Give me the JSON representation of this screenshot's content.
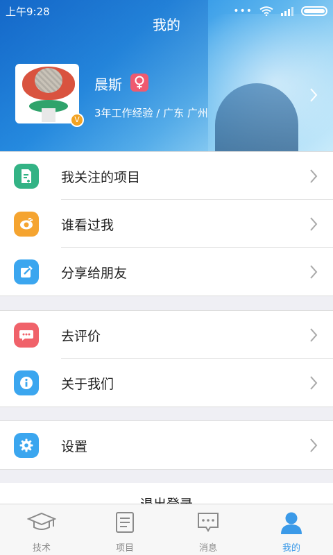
{
  "status_bar": {
    "time": "上午9:28",
    "dots": "•••"
  },
  "header": {
    "title": "我的",
    "user": {
      "name": "晨斯",
      "gender": "female",
      "vip_badge": "V",
      "meta": "3年工作经验 / 广东 广州"
    }
  },
  "menu_groups": [
    {
      "items": [
        {
          "label": "我关注的项目",
          "icon": "follow-project-icon",
          "color": "#33b385"
        },
        {
          "label": "谁看过我",
          "icon": "eye-icon",
          "color": "#f5a430"
        },
        {
          "label": "分享给朋友",
          "icon": "share-icon",
          "color": "#3ba6ef"
        }
      ]
    },
    {
      "items": [
        {
          "label": "去评价",
          "icon": "comment-icon",
          "color": "#f0626a"
        },
        {
          "label": "关于我们",
          "icon": "info-icon",
          "color": "#3ba6ef"
        }
      ]
    },
    {
      "items": [
        {
          "label": "设置",
          "icon": "gear-icon",
          "color": "#3ba6ef"
        }
      ]
    }
  ],
  "logout_label": "退出登录",
  "tabs": [
    {
      "label": "技术",
      "icon": "graduation-cap-icon",
      "active": false
    },
    {
      "label": "项目",
      "icon": "document-list-icon",
      "active": false
    },
    {
      "label": "消息",
      "icon": "message-icon",
      "active": false
    },
    {
      "label": "我的",
      "icon": "person-icon",
      "active": true
    }
  ],
  "colors": {
    "accent": "#3b9ae8",
    "tab_inactive": "#8a8a8a",
    "background": "#efeff4"
  }
}
